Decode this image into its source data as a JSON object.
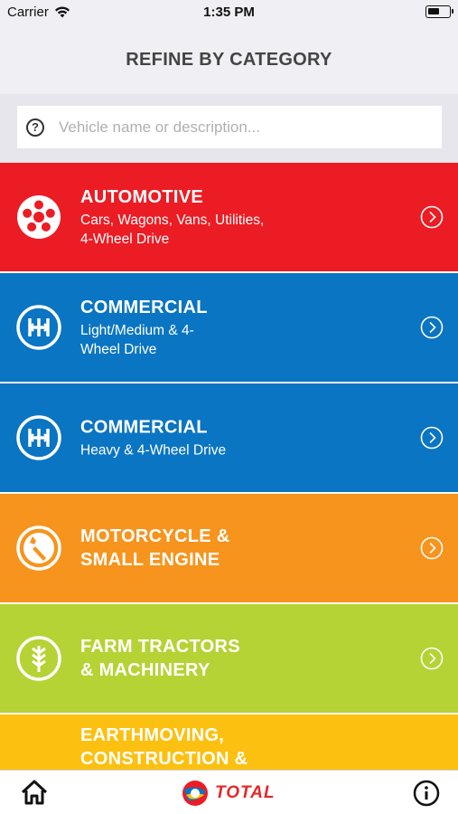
{
  "status_bar": {
    "carrier": "Carrier",
    "time": "1:35 PM"
  },
  "header": {
    "title": "REFINE BY CATEGORY"
  },
  "search": {
    "placeholder": "Vehicle name or description...",
    "value": "",
    "help_icon": "?"
  },
  "categories": [
    {
      "title": "AUTOMOTIVE",
      "subtitle": "Cars, Wagons, Vans, Utilities,\n4-Wheel Drive",
      "color": "#ec1c24",
      "icon": "wheel-icon"
    },
    {
      "title": "COMMERCIAL",
      "subtitle": "Light/Medium & 4-\nWheel Drive",
      "color": "#0a75c2",
      "icon": "gearbox-icon"
    },
    {
      "title": "COMMERCIAL",
      "subtitle": "Heavy & 4-Wheel Drive",
      "color": "#0a75c2",
      "icon": "gearbox-icon"
    },
    {
      "title": "MOTORCYCLE &\nSMALL ENGINE",
      "subtitle": "",
      "color": "#f7941d",
      "icon": "wrench-icon"
    },
    {
      "title": "FARM TRACTORS\n& MACHINERY",
      "subtitle": "",
      "color": "#b5d334",
      "icon": "wheat-icon"
    },
    {
      "title": "EARTHMOVING,\nCONSTRUCTION &",
      "subtitle": "",
      "color": "#fcc010",
      "icon": "gear-icon"
    }
  ],
  "tab_bar": {
    "home_icon": "home-icon",
    "logo_text": "TOTAL",
    "info_icon": "info-icon"
  }
}
